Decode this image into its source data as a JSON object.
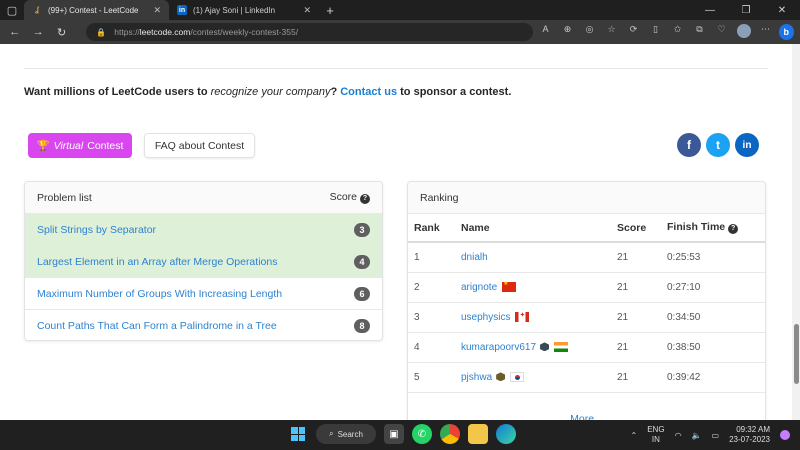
{
  "browser": {
    "tabs": [
      {
        "title": "(99+) Contest - LeetCode",
        "active": true
      },
      {
        "title": "(1) Ajay Soni | LinkedIn",
        "active": false
      }
    ],
    "url_prefix": "https://",
    "url_host": "leetcode.com",
    "url_path": "/contest/weekly-contest-355/"
  },
  "sponsor": {
    "part1": "Want millions of LeetCode users to ",
    "italic": "recognize your company",
    "part2": "? ",
    "link": "Contact us",
    "part3": " to sponsor a contest."
  },
  "buttons": {
    "virtual_italic": "Virtual",
    "virtual_rest": "Contest",
    "faq": "FAQ about Contest"
  },
  "social": {
    "fb": "f",
    "tw": "t",
    "li": "in"
  },
  "problems": {
    "header": "Problem list",
    "score_label": "Score",
    "items": [
      {
        "name": "Split Strings by Separator",
        "points": "3",
        "solved": true
      },
      {
        "name": "Largest Element in an Array after Merge Operations",
        "points": "4",
        "solved": true
      },
      {
        "name": "Maximum Number of Groups With Increasing Length",
        "points": "6",
        "solved": false
      },
      {
        "name": "Count Paths That Can Form a Palindrome in a Tree",
        "points": "8",
        "solved": false
      }
    ]
  },
  "ranking": {
    "title": "Ranking",
    "columns": [
      "Rank",
      "Name",
      "Score",
      "Finish Time"
    ],
    "rows": [
      {
        "rank": "1",
        "name": "dnialh",
        "score": "21",
        "time": "0:25:53"
      },
      {
        "rank": "2",
        "name": "arignote",
        "score": "21",
        "time": "0:27:10"
      },
      {
        "rank": "3",
        "name": "usephysics",
        "score": "21",
        "time": "0:34:50"
      },
      {
        "rank": "4",
        "name": "kumarapoorv617",
        "score": "21",
        "time": "0:38:50"
      },
      {
        "rank": "5",
        "name": "pjshwa",
        "score": "21",
        "time": "0:39:42"
      }
    ],
    "more": "More..."
  },
  "taskbar": {
    "search": "Search",
    "lang1": "ENG",
    "lang2": "IN",
    "time": "09:32 AM",
    "date": "23-07-2023"
  },
  "colors": {
    "accent_link": "#2e82cf",
    "virtual_button": "#d946ef",
    "solved_row": "#dff0d8"
  }
}
